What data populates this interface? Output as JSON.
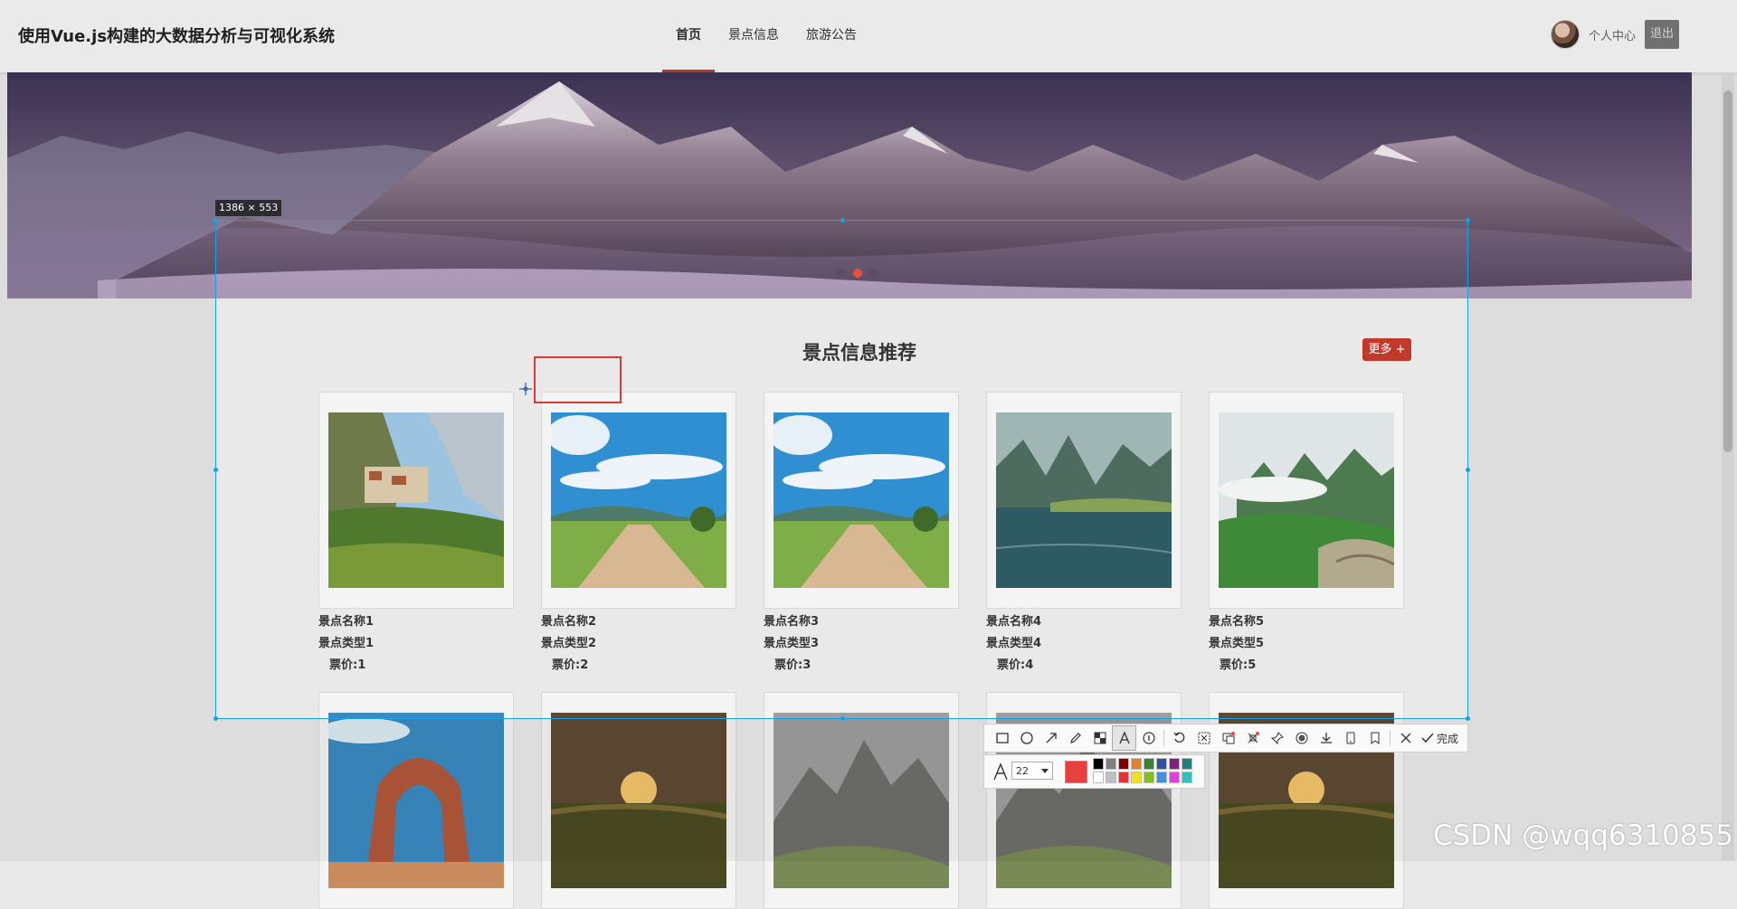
{
  "header": {
    "site_title": "使用Vue.js构建的大数据分析与可视化系统",
    "nav": [
      {
        "label": "首页",
        "active": true
      },
      {
        "label": "景点信息",
        "active": false
      },
      {
        "label": "旅游公告",
        "active": false
      }
    ],
    "user_center": "个人中心",
    "logout": "退出"
  },
  "banner": {
    "carousel_dots": 3,
    "active_dot": 1
  },
  "section": {
    "title": "景点信息推荐",
    "more_label": "更多 +"
  },
  "cards_row1": [
    {
      "name": "景点名称1",
      "type": "景点类型1",
      "price": "票价:1",
      "image": "village-cliff"
    },
    {
      "name": "景点名称2",
      "type": "景点类型2",
      "price": "票价:2",
      "image": "country-road"
    },
    {
      "name": "景点名称3",
      "type": "景点类型3",
      "price": "票价:3",
      "image": "country-road"
    },
    {
      "name": "景点名称4",
      "type": "景点类型4",
      "price": "票价:4",
      "image": "karst-lake"
    },
    {
      "name": "景点名称5",
      "type": "景点类型5",
      "price": "票价:5",
      "image": "misty-mountains"
    }
  ],
  "cards_row2": [
    {
      "image": "stone-arch"
    },
    {
      "image": "sunset-field"
    },
    {
      "image": "rocky-peaks"
    },
    {
      "image": "rocky-peaks"
    },
    {
      "image": "sunset-field"
    }
  ],
  "screenshot_tool": {
    "size_label": "1386 × 553",
    "done_label": "完成",
    "font_size": "22",
    "current_color": "#e8403e",
    "tools": [
      "rectangle-icon",
      "ellipse-icon",
      "arrow-icon",
      "pencil-icon",
      "mosaic-icon",
      "text-icon",
      "serial-number-icon",
      "undo-icon",
      "ocr-icon",
      "translate-icon",
      "scroll-capture-icon",
      "pin-icon",
      "record-icon",
      "download-icon",
      "phone-icon",
      "bookmark-icon",
      "cancel-icon"
    ],
    "swatches": [
      "#000000",
      "#808080",
      "#800000",
      "#e08030",
      "#408030",
      "#3050a0",
      "#802080",
      "#208080",
      "#ffffff",
      "#c0c0c0",
      "#e83030",
      "#f0e020",
      "#80c020",
      "#4090e0",
      "#e040e0",
      "#30c0c0"
    ]
  },
  "watermark": "CSDN @wqq6310855"
}
